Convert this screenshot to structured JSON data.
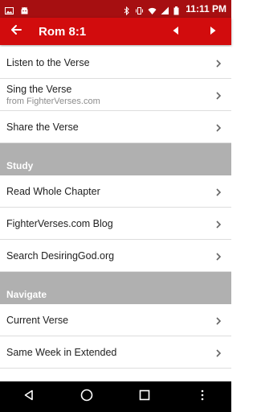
{
  "status_bar": {
    "time": "11:11 PM",
    "left_icons": [
      "image-icon",
      "android-icon"
    ],
    "right_icons": [
      "bluetooth-icon",
      "vibrate-icon",
      "wifi-icon",
      "signal-icon",
      "battery-icon"
    ]
  },
  "app_bar": {
    "title": "Rom 8:1",
    "back_icon": "arrow-back-icon",
    "prev_icon": "triangle-left-icon",
    "next_icon": "triangle-right-icon",
    "color": "#d20c0d",
    "status_color": "#a60f11"
  },
  "list": {
    "top_items": [
      {
        "label": "Listen to the Verse"
      },
      {
        "label": "Sing the Verse",
        "sublabel": "from FighterVerses.com"
      },
      {
        "label": "Share the Verse"
      }
    ],
    "study": {
      "header": "Study",
      "items": [
        {
          "label": "Read Whole Chapter"
        },
        {
          "label": "FighterVerses.com Blog"
        },
        {
          "label": "Search DesiringGod.org"
        }
      ]
    },
    "navigate": {
      "header": "Navigate",
      "items": [
        {
          "label": "Current Verse"
        },
        {
          "label": "Same Week in Extended"
        }
      ]
    }
  },
  "nav_bar": {
    "icons": [
      "back-triangle-icon",
      "home-circle-icon",
      "recents-square-icon",
      "more-dots-icon"
    ]
  }
}
